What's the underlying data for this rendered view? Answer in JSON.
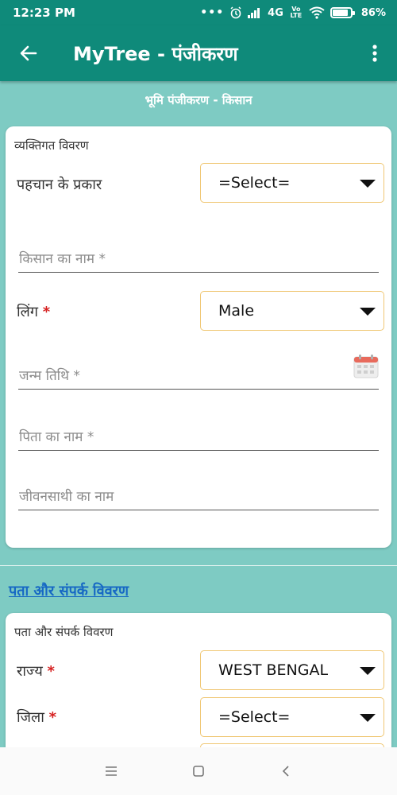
{
  "status": {
    "time": "12:23 PM",
    "dots": "•••",
    "network": "4G",
    "volte": "Vo LTE",
    "battery": "86%"
  },
  "appbar": {
    "title": "MyTree - पंजीकरण"
  },
  "page": {
    "section_title": "भूमि पंजीकरण - किसान"
  },
  "personal": {
    "heading": "व्यक्तिगत विवरण",
    "id_type_label": "पहचान के प्रकार",
    "id_type_value": "=Select=",
    "farmer_name_placeholder": "किसान का नाम *",
    "gender_label": "लिंग",
    "gender_value": "Male",
    "dob_placeholder": "जन्म तिथि *",
    "father_name_placeholder": "पिता का नाम *",
    "spouse_name_placeholder": "जीवनसाथी का नाम"
  },
  "address": {
    "link_heading": "पता और संपर्क विवरण",
    "heading": "पता और संपर्क विवरण",
    "state_label": "राज्य",
    "state_value": "WEST BENGAL",
    "district_label": "जिला",
    "district_value": "=Select="
  },
  "required_marker": "*",
  "colors": {
    "primary": "#0f8a7a",
    "background": "#7ecbc3",
    "select_border": "#f0c774",
    "required": "#d62020",
    "link": "#1668c4"
  },
  "icons": {
    "back": "arrow-left-icon",
    "menu": "more-vertical-icon",
    "calendar": "calendar-icon",
    "dropdown": "caret-down-icon"
  }
}
